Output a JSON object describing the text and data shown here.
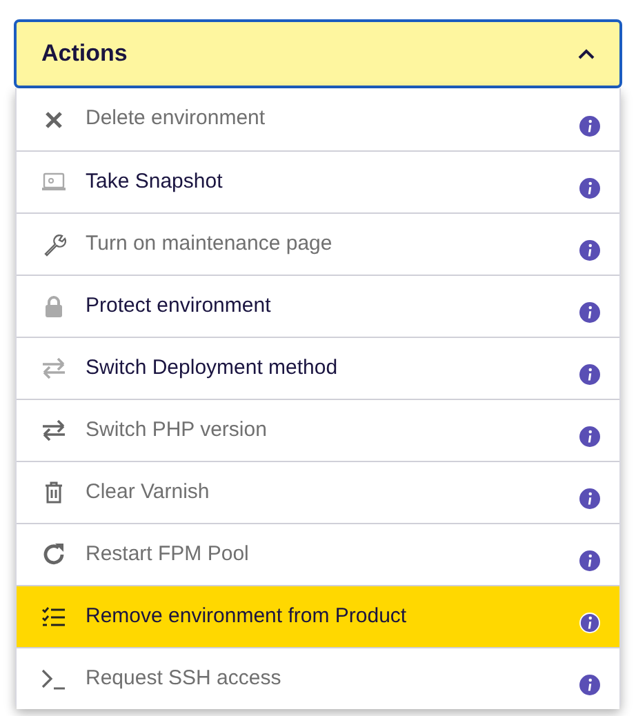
{
  "dropdown": {
    "label": "Actions",
    "expanded": true
  },
  "items": [
    {
      "label": "Delete environment",
      "kind": "cross",
      "disabled": true,
      "selected": false
    },
    {
      "label": "Take Snapshot",
      "kind": "snapshot",
      "disabled": false,
      "selected": false
    },
    {
      "label": "Turn on maintenance page",
      "kind": "wrench",
      "disabled": true,
      "selected": false
    },
    {
      "label": "Protect environment",
      "kind": "lock",
      "disabled": false,
      "selected": false
    },
    {
      "label": "Switch Deployment method",
      "kind": "swap",
      "disabled": false,
      "selected": false
    },
    {
      "label": "Switch PHP version",
      "kind": "swap",
      "disabled": true,
      "selected": false
    },
    {
      "label": "Clear Varnish",
      "kind": "trash",
      "disabled": true,
      "selected": false
    },
    {
      "label": "Restart FPM Pool",
      "kind": "restart",
      "disabled": true,
      "selected": false
    },
    {
      "label": "Remove environment from Product",
      "kind": "checklist",
      "disabled": false,
      "selected": true
    },
    {
      "label": "Request SSH access",
      "kind": "terminal",
      "disabled": true,
      "selected": false
    }
  ]
}
